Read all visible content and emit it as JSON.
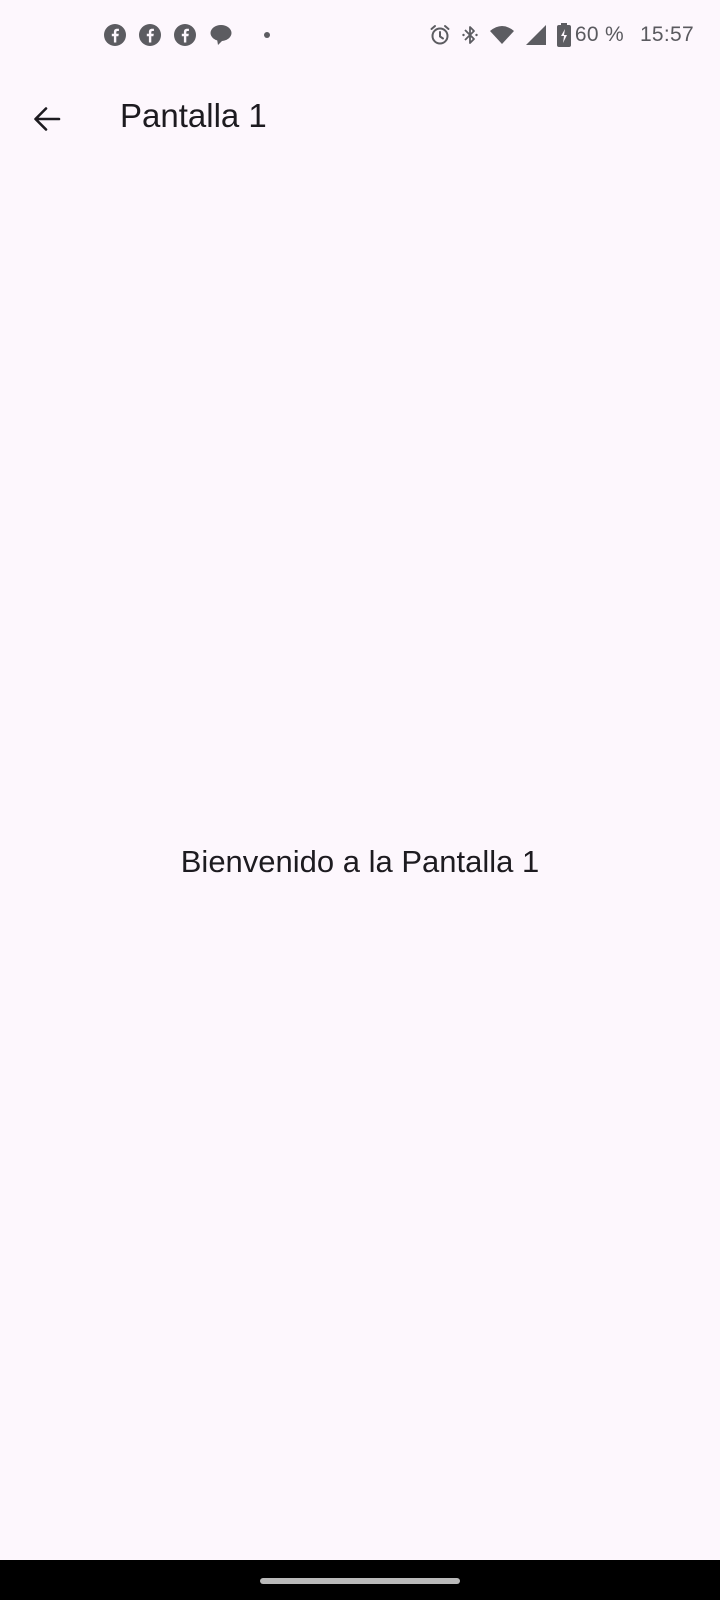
{
  "status_bar": {
    "notification_icons": [
      "facebook-icon",
      "facebook-icon",
      "facebook-icon",
      "chat-bubble-icon",
      "more-dot-icon"
    ],
    "system_icons": [
      "alarm-icon",
      "bluetooth-icon",
      "wifi-icon",
      "signal-icon",
      "battery-charging-icon"
    ],
    "battery_level": "60 %",
    "time": "15:57",
    "icon_color": "#5c5c61"
  },
  "app_bar": {
    "back_icon": "arrow-back-icon",
    "title": "Pantalla 1"
  },
  "content": {
    "message": "Bienvenido a la Pantalla 1"
  },
  "colors": {
    "background": "#fdf7fd",
    "text": "#1d1b20",
    "nav_bar": "#000000"
  }
}
